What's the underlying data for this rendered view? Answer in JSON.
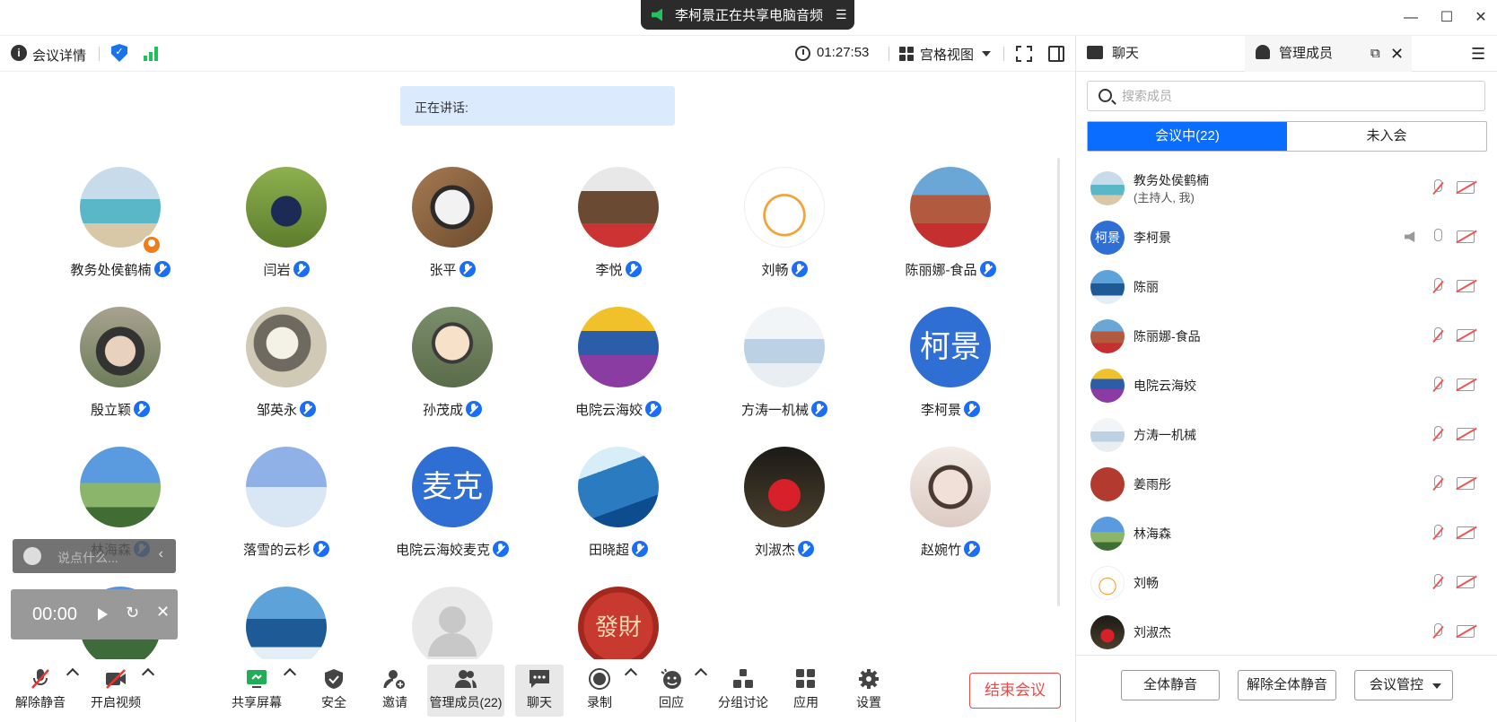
{
  "window": {
    "share_banner": "李柯景正在共享电脑音频",
    "minimize": "—",
    "maximize": "☐",
    "close": "✕"
  },
  "header": {
    "meeting_info": "会议详情",
    "timer": "01:27:53",
    "view_mode": "宫格视图"
  },
  "speaking_label": "正在讲话:",
  "participants": [
    {
      "name": "教务处侯鹤楠",
      "avatar": "g-sea",
      "host": true
    },
    {
      "name": "闫岩",
      "avatar": "g-park"
    },
    {
      "name": "张平",
      "avatar": "g-dog"
    },
    {
      "name": "李悦",
      "avatar": "g-fam"
    },
    {
      "name": "刘畅",
      "avatar": "g-rooster"
    },
    {
      "name": "陈丽娜-食品",
      "avatar": "g-lin"
    },
    {
      "name": "殷立颖",
      "avatar": "g-woman"
    },
    {
      "name": "邹英永",
      "avatar": "g-cup"
    },
    {
      "name": "孙茂成",
      "avatar": "g-cartoon"
    },
    {
      "name": "电院云海姣",
      "avatar": "g-kid2"
    },
    {
      "name": "方涛一机械",
      "avatar": "g-window"
    },
    {
      "name": "李柯景",
      "avatar": "text",
      "avatar_text": "柯景"
    },
    {
      "name": "林海森",
      "avatar": "g-field"
    },
    {
      "name": "落雪的云杉",
      "avatar": "g-walk"
    },
    {
      "name": "电院云海姣麦克",
      "avatar": "text",
      "avatar_text": "麦克"
    },
    {
      "name": "田晓超",
      "avatar": "g-wave"
    },
    {
      "name": "刘淑杰",
      "avatar": "g-lantern"
    },
    {
      "name": "赵婉竹",
      "avatar": "g-girl"
    },
    {
      "name": "",
      "avatar": "g-sky"
    },
    {
      "name": "",
      "avatar": "g-ocean"
    },
    {
      "name": "",
      "avatar": "g-default"
    },
    {
      "name": "",
      "avatar": "g-fortune",
      "avatar_text": "發財"
    }
  ],
  "comment": {
    "placeholder": "说点什么...",
    "collapse": "‹"
  },
  "player": {
    "time": "00:00",
    "replay": "↻",
    "close": "✕"
  },
  "toolbar": {
    "unmute": "解除静音",
    "start_video": "开启视频",
    "share_screen": "共享屏幕",
    "security": "安全",
    "invite": "邀请",
    "members": "管理成员(22)",
    "chat": "聊天",
    "record": "录制",
    "reaction": "回应",
    "breakout": "分组讨论",
    "apps": "应用",
    "settings": "设置",
    "end_meeting": "结束会议"
  },
  "panel": {
    "tab_chat": "聊天",
    "tab_members": "管理成员",
    "search_placeholder": "搜索成员",
    "seg_in_meeting": "会议中(22)",
    "seg_not_joined": "未入会",
    "members": [
      {
        "name": "教务处侯鹤楠",
        "sub": "(主持人, 我)",
        "avatar": "g-sea"
      },
      {
        "name": "李柯景",
        "avatar": "text",
        "avatar_text": "柯景",
        "speaking": true
      },
      {
        "name": "陈丽",
        "avatar": "g-ocean"
      },
      {
        "name": "陈丽娜-食品",
        "avatar": "g-lin"
      },
      {
        "name": "电院云海姣",
        "avatar": "g-kid2"
      },
      {
        "name": "方涛一机械",
        "avatar": "g-window"
      },
      {
        "name": "姜雨彤",
        "avatar": "g-jiang"
      },
      {
        "name": "林海森",
        "avatar": "g-field"
      },
      {
        "name": "刘畅",
        "avatar": "g-rooster"
      },
      {
        "name": "刘淑杰",
        "avatar": "g-lantern"
      }
    ],
    "mute_all": "全体静音",
    "unmute_all": "解除全体静音",
    "meeting_control": "会议管控"
  }
}
